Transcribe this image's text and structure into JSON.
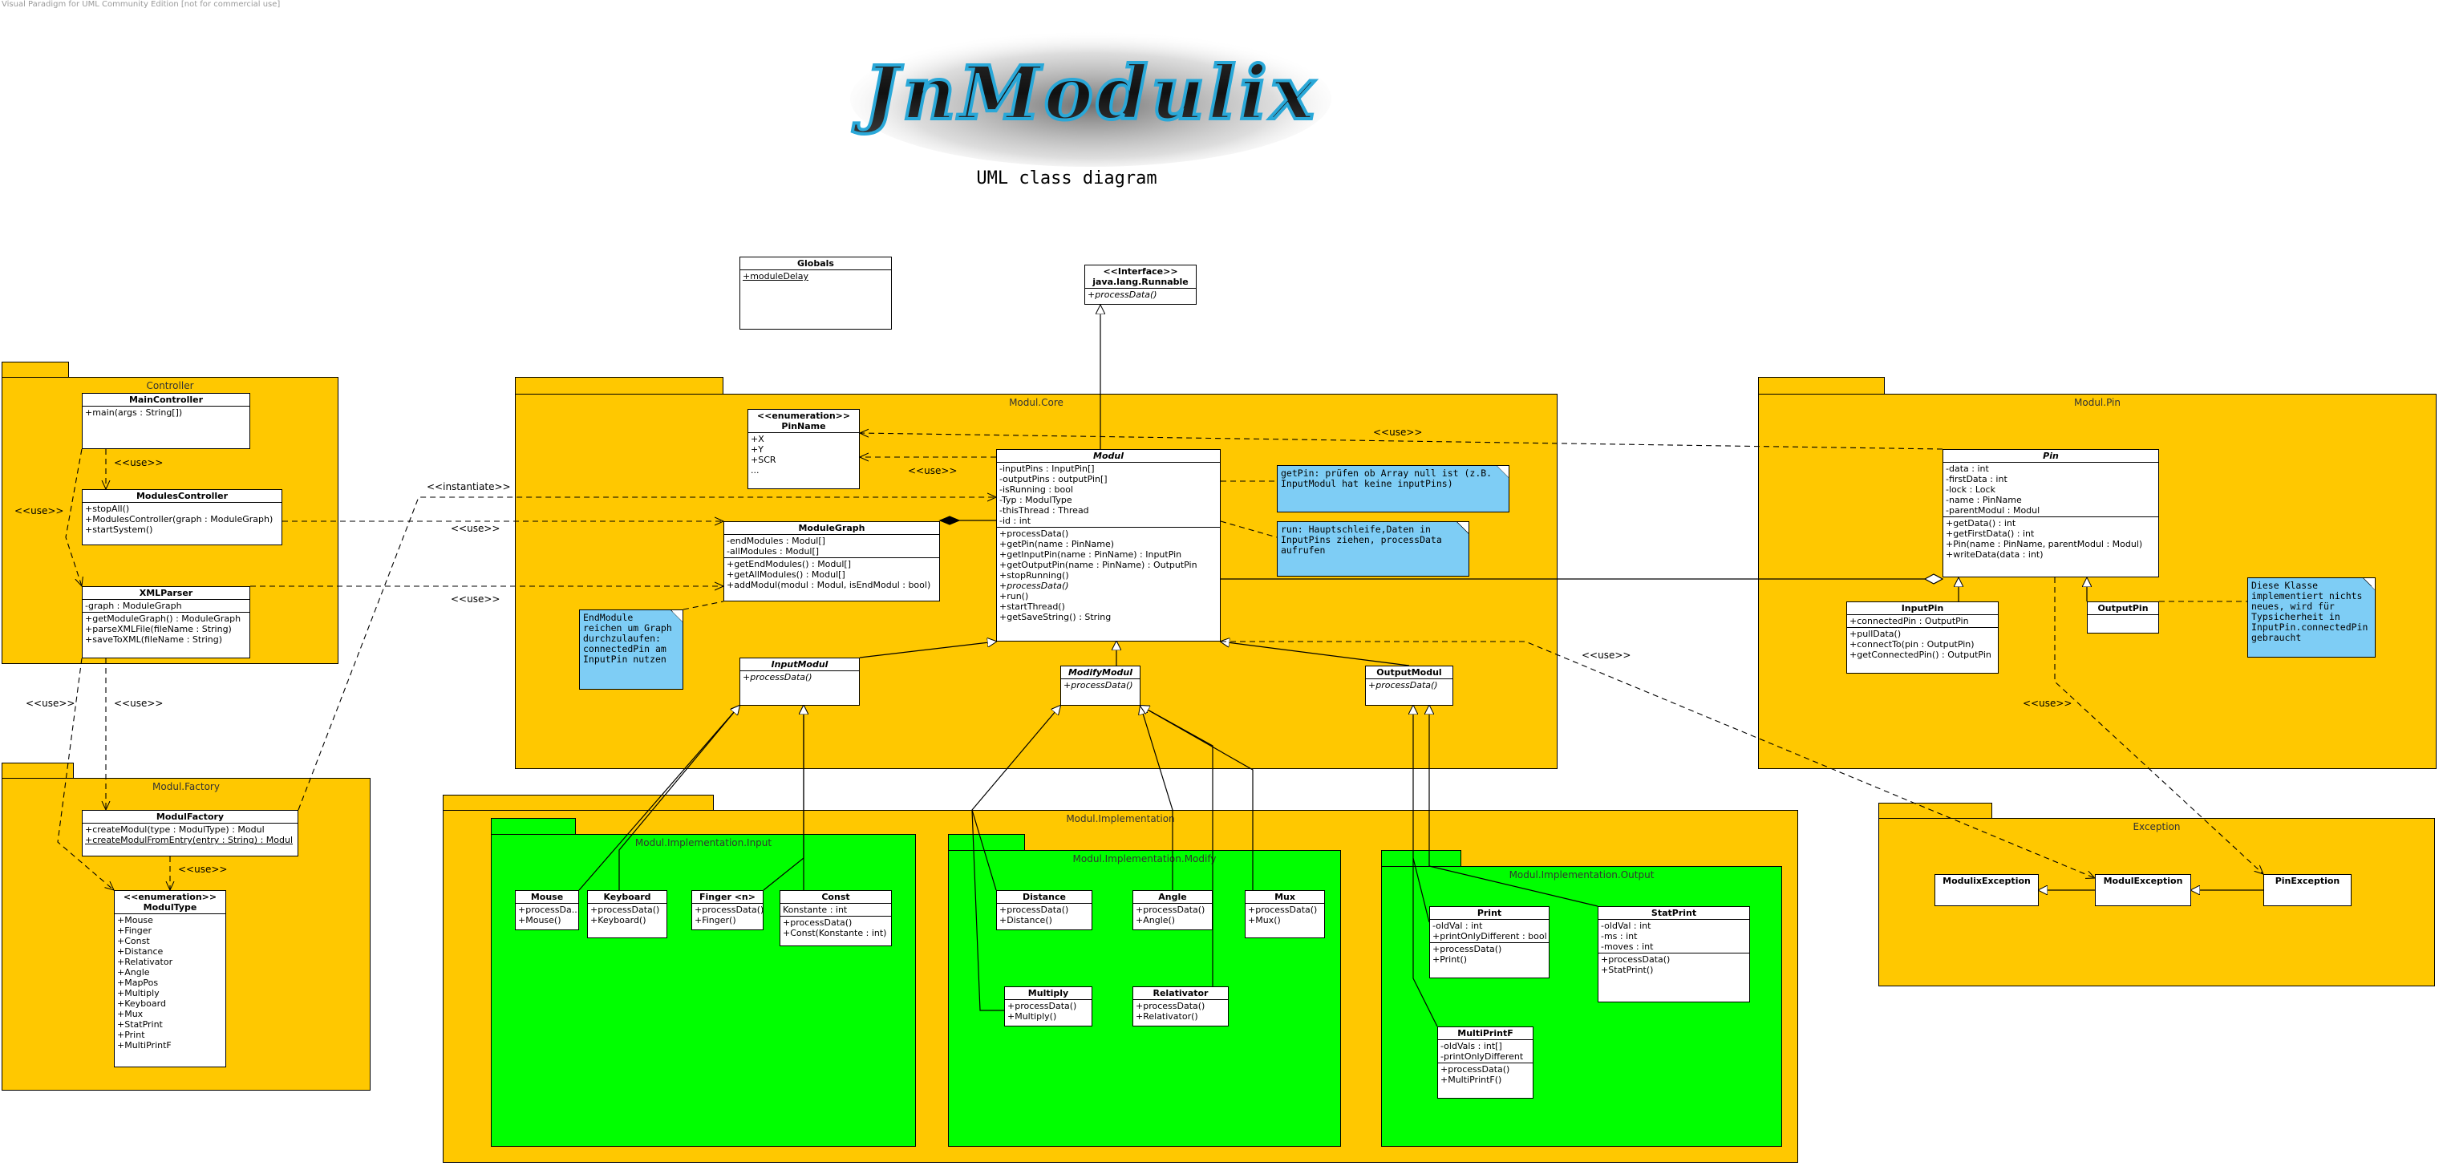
{
  "watermark": "Visual Paradigm for UML Community Edition [not for commercial use]",
  "logo": {
    "text": "JnModulix"
  },
  "title": "UML class diagram",
  "packages": {
    "controller": "Controller",
    "factory": "Modul.Factory",
    "core": "Modul.Core",
    "pin": "Modul.Pin",
    "impl": "Modul.Implementation",
    "impl_input": "Modul.Implementation.Input",
    "impl_modify": "Modul.Implementation.Modify",
    "impl_output": "Modul.Implementation.Output",
    "exception": "Exception"
  },
  "classes": {
    "globals": {
      "name": "Globals",
      "attrs": [
        "+moduleDelay"
      ]
    },
    "runnable": {
      "stereotype": "<<Interface>>",
      "name": "java.lang.Runnable",
      "ops": [
        "+processData()"
      ]
    },
    "maincontroller": {
      "name": "MainController",
      "ops": [
        "+main(args : String[])"
      ]
    },
    "modulescontroller": {
      "name": "ModulesController",
      "ops": [
        "+stopAll()",
        "+ModulesController(graph : ModuleGraph)",
        "+startSystem()"
      ]
    },
    "xmlparser": {
      "name": "XMLParser",
      "attrs": [
        "-graph : ModuleGraph"
      ],
      "ops": [
        "+getModuleGraph() : ModuleGraph",
        "+parseXMLFile(fileName : String)",
        "+saveToXML(fileName : String)"
      ]
    },
    "modulfactory": {
      "name": "ModulFactory",
      "ops": [
        "+createModul(type : ModulType) : Modul",
        "+createModulFromEntry(entry : String) : Modul"
      ]
    },
    "modultype": {
      "stereotype": "<<enumeration>>",
      "name": "ModulType",
      "attrs": [
        "+Mouse",
        "+Finger",
        "+Const",
        "+Distance",
        "+Relativator",
        "+Angle",
        "+MapPos",
        "+Multiply",
        "+Keyboard",
        "+Mux",
        "+StatPrint",
        "+Print",
        "+MultiPrintF"
      ]
    },
    "pinname": {
      "stereotype": "<<enumeration>>",
      "name": "PinName",
      "attrs": [
        "+X",
        "+Y",
        "+SCR",
        "..."
      ]
    },
    "modulegraph": {
      "name": "ModuleGraph",
      "attrs": [
        "-endModules : Modul[]",
        "-allModules : Modul[]"
      ],
      "ops": [
        "+getEndModules() : Modul[]",
        "+getAllModules() : Modul[]",
        "+addModul(modul : Modul, isEndModul : bool)"
      ]
    },
    "modul": {
      "name": "Modul",
      "attrs": [
        "-inputPins : InputPin[]",
        "-outputPins : outputPin[]",
        "-isRunning : bool",
        "-Typ : ModulType",
        "-thisThread : Thread",
        "-id : int"
      ],
      "ops": [
        "+processData()",
        "+getPin(name : PinName)",
        "+getInputPin(name : PinName) : InputPin",
        "+getOutputPin(name : PinName) : OutputPin",
        "+stopRunning()",
        "+processData()",
        "+run()",
        "+startThread()",
        "+getSaveString() : String"
      ]
    },
    "inputmodul": {
      "name": "InputModul",
      "ops": [
        "+processData()"
      ]
    },
    "modifymodul": {
      "name": "ModifyModul",
      "ops": [
        "+processData()"
      ]
    },
    "outputmodul": {
      "name": "OutputModul",
      "ops": [
        "+processData()"
      ]
    },
    "pin": {
      "name": "Pin",
      "attrs": [
        "-data : int",
        "-firstData : int",
        "-lock : Lock",
        "-name : PinName",
        "-parentModul : Modul"
      ],
      "ops": [
        "+getData() : int",
        "+getFirstData() : int",
        "+Pin(name : PinName, parentModul : Modul)",
        "+writeData(data : int)"
      ]
    },
    "inputpin": {
      "name": "InputPin",
      "attrs": [
        "+connectedPin : OutputPin"
      ],
      "ops": [
        "+pullData()",
        "+connectTo(pin : OutputPin)",
        "+getConnectedPin() : OutputPin"
      ]
    },
    "outputpin": {
      "name": "OutputPin"
    },
    "mouse": {
      "name": "Mouse",
      "ops": [
        "+processDa...",
        "+Mouse()"
      ]
    },
    "keyboard": {
      "name": "Keyboard",
      "ops": [
        "+processData()",
        "+Keyboard()"
      ]
    },
    "finger": {
      "name": "Finger <n>",
      "ops": [
        "+processData()",
        "+Finger()"
      ]
    },
    "const": {
      "name": "Const",
      "attrs": [
        "Konstante : int"
      ],
      "ops": [
        "+processData()",
        "+Const(Konstante : int)"
      ]
    },
    "distance": {
      "name": "Distance",
      "ops": [
        "+processData()",
        "+Distance()"
      ]
    },
    "angle": {
      "name": "Angle",
      "ops": [
        "+processData()",
        "+Angle()"
      ]
    },
    "mux": {
      "name": "Mux",
      "ops": [
        "+processData()",
        "+Mux()"
      ]
    },
    "multiply": {
      "name": "Multiply",
      "ops": [
        "+processData()",
        "+Multiply()"
      ]
    },
    "relativator": {
      "name": "Relativator",
      "ops": [
        "+processData()",
        "+Relativator()"
      ]
    },
    "print": {
      "name": "Print",
      "attrs": [
        "-oldVal : int",
        "+printOnlyDifferent : bool"
      ],
      "ops": [
        "+processData()",
        "+Print()"
      ]
    },
    "statprint": {
      "name": "StatPrint",
      "attrs": [
        "-oldVal : int",
        "-ms : int",
        "-moves : int"
      ],
      "ops": [
        "+processData()",
        "+StatPrint()"
      ]
    },
    "multiprintf": {
      "name": "MultiPrintF",
      "attrs": [
        "-oldVals : int[]",
        "-printOnlyDifferent"
      ],
      "ops": [
        "+processData()",
        "+MultiPrintF()"
      ]
    },
    "modulixexception": {
      "name": "ModulixException"
    },
    "modulexception": {
      "name": "ModulException"
    },
    "pinexception": {
      "name": "PinException"
    }
  },
  "notes": {
    "getpin": "getPin: prüfen ob Array null ist (z.B.\nInputModul hat keine inputPins)",
    "run": "run: Hauptschleife,Daten in\nInputPins ziehen, processData\naufrufen",
    "endmodule": "EndModule\nreichen um Graph\ndurchzulaufen:\nconnectedPin am\nInputPin nutzen",
    "outputpin": "Diese Klasse\nimplementiert nichts\nneues, wird für\nTypsicherheit in\nInputPin.connectedPin\ngebraucht"
  },
  "stereotypes": {
    "use": "<<use>>",
    "instantiate": "<<instantiate>>"
  }
}
